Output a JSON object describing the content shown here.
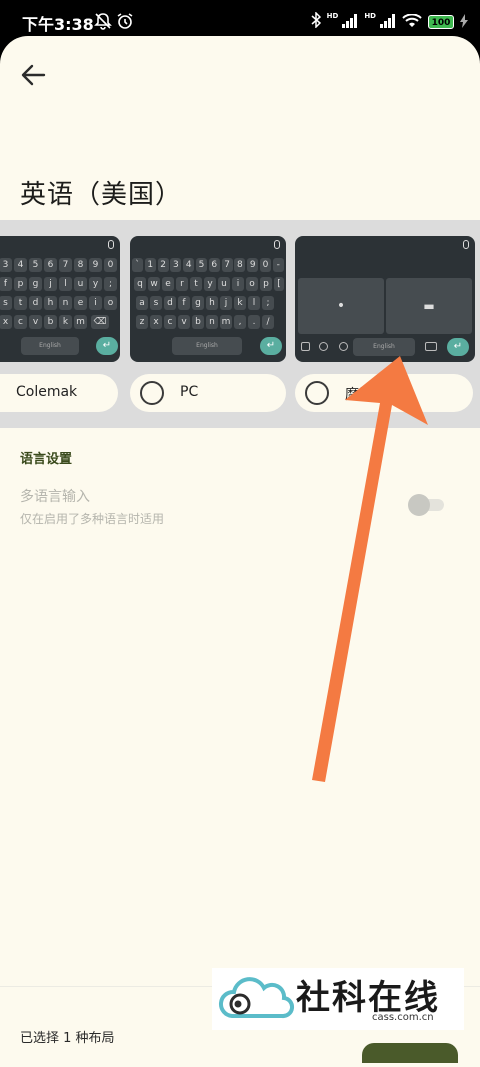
{
  "status_bar": {
    "time": "下午3:38",
    "hd1": "HD",
    "hd2": "HD",
    "battery": "100",
    "icons": [
      "mute-icon",
      "alarm-icon",
      "bluetooth-icon",
      "signal-icon",
      "wifi-icon",
      "battery-icon",
      "charging-icon"
    ]
  },
  "header": {
    "title": "英语（美国）",
    "back_icon": "arrow-left-icon"
  },
  "layouts": {
    "options": [
      {
        "label": "Colemak",
        "selected": false
      },
      {
        "label": "PC",
        "selected": false
      },
      {
        "label": "摩斯",
        "selected": false
      }
    ],
    "keyboard": {
      "space_label": "English",
      "numbers": [
        "3",
        "4",
        "5",
        "6",
        "7",
        "8",
        "9",
        "0"
      ],
      "pc_numbers": [
        "`",
        "1",
        "2",
        "3",
        "4",
        "5",
        "6",
        "7",
        "8",
        "9",
        "0",
        "-"
      ],
      "colemak_row1": [
        "f",
        "p",
        "g",
        "j",
        "l",
        "u",
        "y"
      ],
      "colemak_row2": [
        "s",
        "t",
        "d",
        "h",
        "n",
        "e",
        "i"
      ],
      "colemak_row3": [
        "x",
        "c",
        "v",
        "b",
        "k",
        "m"
      ],
      "pc_row1": [
        "q",
        "w",
        "e",
        "r",
        "t",
        "y",
        "u",
        "i",
        "o",
        "p"
      ],
      "pc_row2": [
        "a",
        "s",
        "d",
        "f",
        "g",
        "h",
        "j",
        "k",
        "l",
        ";"
      ],
      "pc_row3": [
        "z",
        "x",
        "c",
        "v",
        "b",
        "n",
        "m",
        ",",
        ".",
        "/"
      ],
      "morse_dot": "•",
      "morse_dash": "▬"
    }
  },
  "settings": {
    "section_title": "语言设置",
    "multilang": {
      "title": "多语言输入",
      "subtitle": "仅在启用了多种语言时适用",
      "enabled": false
    }
  },
  "footer": {
    "selected_text": "已选择 1 种布局"
  },
  "watermark": {
    "text": "社科在线",
    "sub": "cass.com.cn"
  },
  "colors": {
    "background": "#fdfaee",
    "strip": "#dcdcdc",
    "keyboard": "#2c3236",
    "key": "#464c50",
    "accent": "#5aaea0",
    "arrow": "#f47a42",
    "section": "#3a4a1c"
  }
}
